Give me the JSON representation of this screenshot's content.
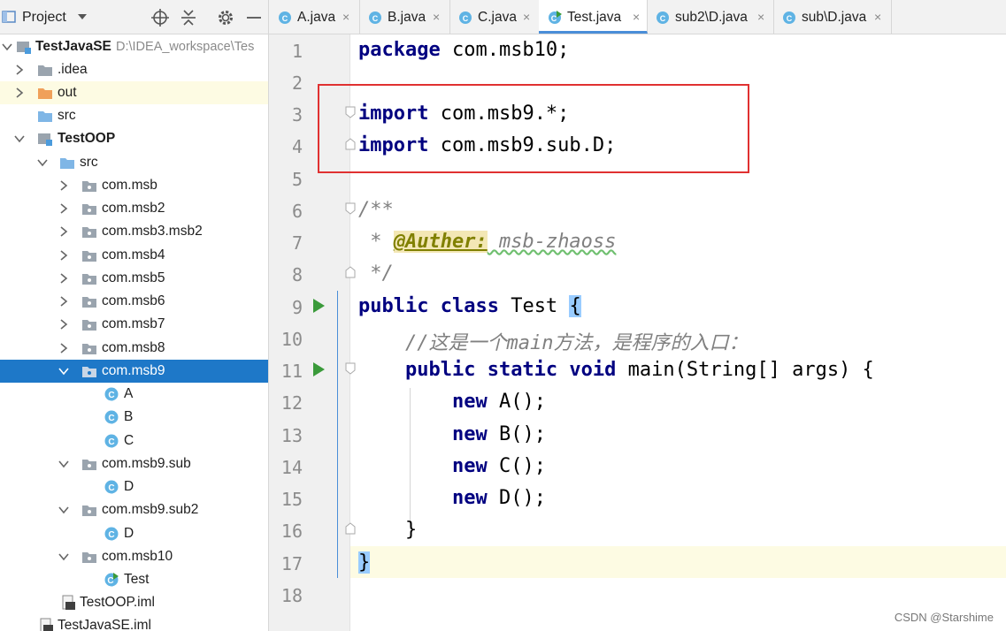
{
  "project_panel": {
    "title": "Project",
    "tree": [
      {
        "label": "TestJavaSE",
        "sub": "D:\\IDEA_workspace\\Tes",
        "bold": true
      },
      {
        "label": ".idea"
      },
      {
        "label": "out"
      },
      {
        "label": "src"
      },
      {
        "label": "TestOOP",
        "bold": true
      },
      {
        "label": "src"
      },
      {
        "label": "com.msb"
      },
      {
        "label": "com.msb2"
      },
      {
        "label": "com.msb3.msb2"
      },
      {
        "label": "com.msb4"
      },
      {
        "label": "com.msb5"
      },
      {
        "label": "com.msb6"
      },
      {
        "label": "com.msb7"
      },
      {
        "label": "com.msb8"
      },
      {
        "label": "com.msb9",
        "selected": true
      },
      {
        "label": "A"
      },
      {
        "label": "B"
      },
      {
        "label": "C"
      },
      {
        "label": "com.msb9.sub"
      },
      {
        "label": "D"
      },
      {
        "label": "com.msb9.sub2"
      },
      {
        "label": "D"
      },
      {
        "label": "com.msb10"
      },
      {
        "label": "Test"
      },
      {
        "label": "TestOOP.iml"
      },
      {
        "label": "TestJavaSE.iml"
      }
    ]
  },
  "tabs": [
    {
      "label": "A.java",
      "close": "×"
    },
    {
      "label": "B.java",
      "close": "×"
    },
    {
      "label": "C.java",
      "close": "×"
    },
    {
      "label": "Test.java",
      "close": "×",
      "active": true
    },
    {
      "label": "sub2\\D.java",
      "close": "×"
    },
    {
      "label": "sub\\D.java",
      "close": "×"
    }
  ],
  "editor": {
    "line_numbers": [
      "1",
      "2",
      "3",
      "4",
      "5",
      "6",
      "7",
      "8",
      "9",
      "10",
      "11",
      "12",
      "13",
      "14",
      "15",
      "16",
      "17",
      "18"
    ],
    "code": {
      "l1_kw": "package",
      "l1_rest": " com.msb10;",
      "l3_kw": "import",
      "l3_rest": " com.msb9.*;",
      "l4_kw": "import",
      "l4_rest": " com.msb9.sub.D;",
      "l6": "/**",
      "l7_star": " * ",
      "l7_ann": "@Auther:",
      "l7_rest": " msb-zhaoss",
      "l8": " */",
      "l9_kw": "public class",
      "l9_rest": " Test ",
      "l9_brace": "{",
      "l10": "    //这是一个main方法，是程序的入口：",
      "l11_indent": "    ",
      "l11_kw": "public static void",
      "l11_rest": " main(String[] args) {",
      "l12_indent": "        ",
      "l12_kw": "new",
      "l12_rest": " A();",
      "l13_indent": "        ",
      "l13_kw": "new",
      "l13_rest": " B();",
      "l14_indent": "        ",
      "l14_kw": "new",
      "l14_rest": " C();",
      "l15_indent": "        ",
      "l15_kw": "new",
      "l15_rest": " D();",
      "l16": "    }",
      "l17": "}"
    }
  },
  "watermark": "CSDN @Starshime",
  "colors": {
    "selection": "#1e78c8",
    "keyword": "#000080",
    "highlight_box": "#e03131"
  }
}
